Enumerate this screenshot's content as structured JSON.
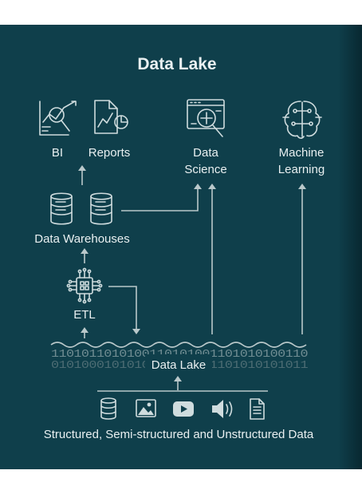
{
  "title": "Data Lake",
  "nodes": {
    "bi": "BI",
    "reports": "Reports",
    "data_science_line1": "Data",
    "data_science_line2": "Science",
    "machine_learning_line1": "Machine",
    "machine_learning_line2": "Learning",
    "data_warehouses": "Data Warehouses",
    "etl": "ETL",
    "data_lake": "Data Lake",
    "sources": "Structured, Semi-structured and Unstructured Data"
  },
  "binary": {
    "top": "1101011010100110101001101010100110",
    "bottom": "0101000101010010100101101010101011"
  },
  "icons": [
    "analytics-chart-icon",
    "report-document-icon",
    "data-science-magnifier-icon",
    "brain-circuit-icon",
    "database-icon",
    "etl-chip-icon",
    "image-icon",
    "video-play-icon",
    "audio-speaker-icon",
    "text-document-icon"
  ],
  "colors": {
    "background": "#0f3f4b",
    "foreground": "#e9f0f1",
    "lines": "#b9c8ca"
  }
}
